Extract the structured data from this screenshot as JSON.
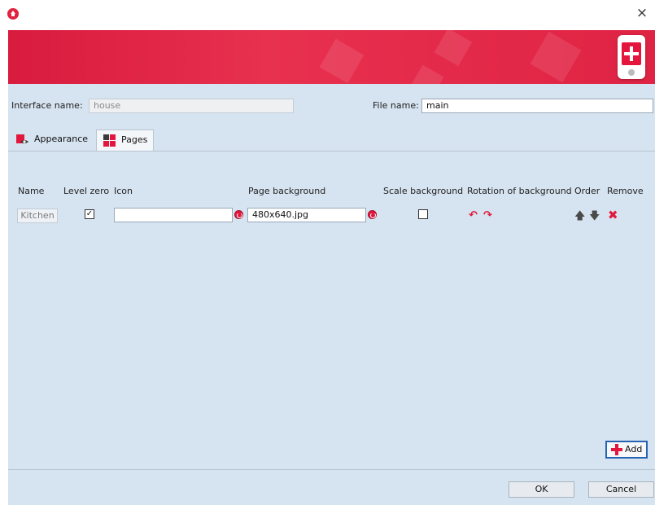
{
  "window": {
    "app_icon": "home-icon",
    "close_label": "×"
  },
  "banner": {
    "accent": "#e3173d",
    "logo_icon": "phone-plus-icon"
  },
  "form": {
    "interface_name_label": "Interface name:",
    "interface_name_value": "house",
    "file_name_label": "File name:",
    "file_name_value": "main"
  },
  "tabs": [
    {
      "label": "Appearance",
      "icon": "appearance-icon",
      "active": false
    },
    {
      "label": "Pages",
      "icon": "pages-icon",
      "active": true
    }
  ],
  "table": {
    "headers": {
      "name": "Name",
      "level_zero": "Level zero",
      "icon": "Icon",
      "page_background": "Page background",
      "scale_background": "Scale background",
      "rotation": "Rotation of background",
      "order": "Order",
      "remove": "Remove"
    },
    "rows": [
      {
        "name": "Kitchen",
        "level_zero": true,
        "icon_value": "",
        "page_background": "480x640.jpg",
        "scale_background": false
      }
    ]
  },
  "buttons": {
    "add": "Add",
    "ok": "OK",
    "cancel": "Cancel"
  }
}
